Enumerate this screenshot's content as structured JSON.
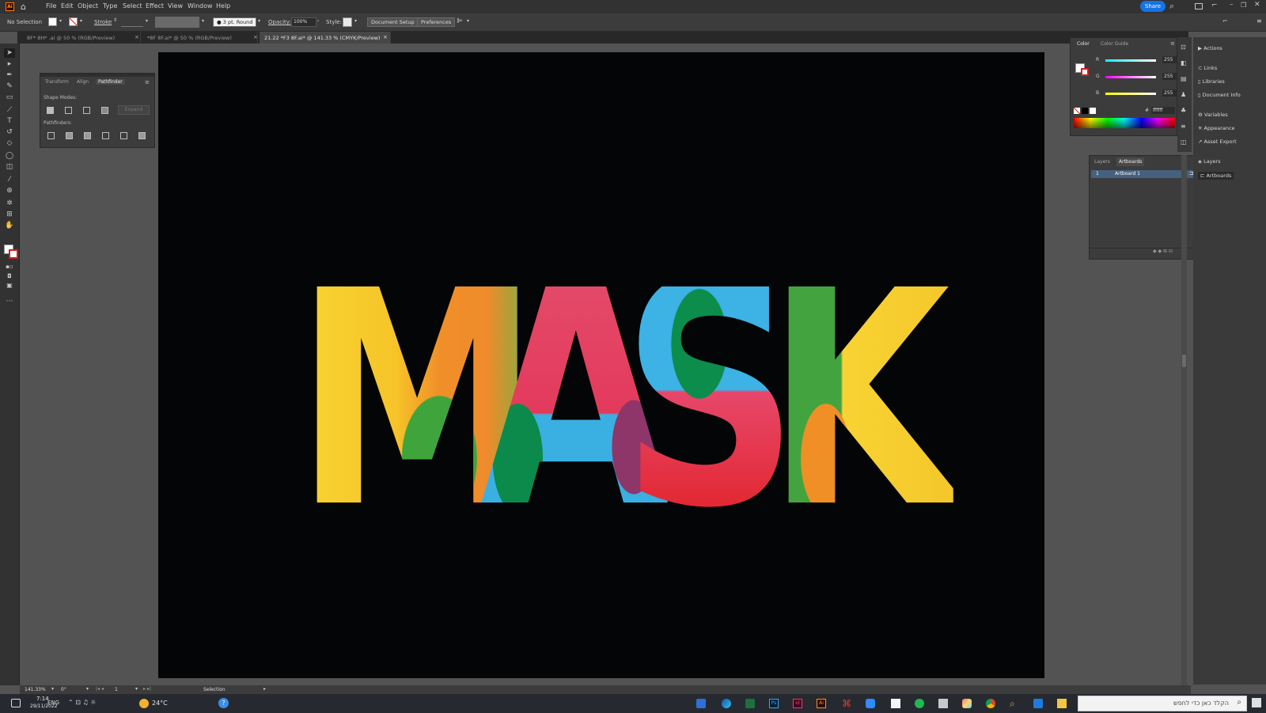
{
  "menubar": {
    "items": [
      "File",
      "Edit",
      "Object",
      "Type",
      "Select",
      "Effect",
      "View",
      "Window",
      "Help"
    ],
    "share_label": "Share"
  },
  "control_bar": {
    "selection_label": "No Selection",
    "stroke_label": "Stroke",
    "brush_label": "3 pt. Round",
    "opacity_label": "Opacity:",
    "opacity_value": "100%",
    "style_label": "Style:",
    "document_setup": "Document Setup",
    "preferences": "Preferences"
  },
  "doc_tabs": [
    {
      "label": "8F* 8H* .ai @ 50 % (RGB/Preview)",
      "active": false
    },
    {
      "label": "*8F 8F.ai* @ 50 % (RGB/Preview)",
      "active": false
    },
    {
      "label": "21.22 *F3 8F.ai* @ 141.33 % (CMYK/Preview)",
      "active": true
    }
  ],
  "artwork": {
    "text": "MASK",
    "letters": [
      {
        "char": "M",
        "colors": [
          "#f7d02c",
          "#f0932a",
          "#41a43d",
          "#7ab648"
        ]
      },
      {
        "char": "A",
        "colors": [
          "#e4506e",
          "#9a3b6b",
          "#0e8a4c",
          "#37b1e4"
        ]
      },
      {
        "char": "S",
        "colors": [
          "#3db3e5",
          "#0b8f4e",
          "#e8456b",
          "#e1262e"
        ]
      },
      {
        "char": "K",
        "colors": [
          "#43a33f",
          "#f8d333",
          "#f09128",
          "#f4c52a"
        ]
      }
    ]
  },
  "pathfinder_panel": {
    "tabs": [
      "Transform",
      "Align",
      "Pathfinder"
    ],
    "shape_modes_label": "Shape Modes:",
    "expand_label": "Expand",
    "pathfinders_label": "Pathfinders:"
  },
  "color_panel": {
    "tabs": [
      "Color",
      "Color Guide"
    ],
    "channels": [
      {
        "label": "R",
        "value": "255",
        "color": "#e03a3a"
      },
      {
        "label": "G",
        "value": "255",
        "color": "#3ab43a"
      },
      {
        "label": "B",
        "value": "255",
        "color": "#3a6ad8"
      }
    ],
    "hex_value": "ffffff"
  },
  "artboards_panel": {
    "tabs": [
      "Layers",
      "Artboards"
    ],
    "rows": [
      {
        "index": "1",
        "name": "Artboard 1"
      }
    ]
  },
  "right_panel": {
    "items": [
      "Actions",
      "Links",
      "Libraries",
      "Document Info",
      "Variables",
      "Appearance",
      "Asset Export",
      "Layers",
      "Artboards"
    ]
  },
  "status_bar": {
    "zoom": "141.33%",
    "rotation": "0°",
    "artboard_index": "1",
    "tool": "Selection"
  },
  "taskbar": {
    "time": "7:14",
    "date": "29/11/2022",
    "weather": "24°C",
    "search_placeholder": "הקלד כאן כדי לחפש",
    "lang": "ENG"
  }
}
